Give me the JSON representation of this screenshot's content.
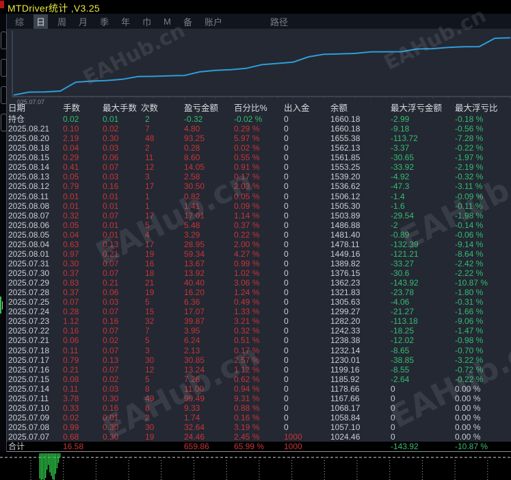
{
  "window": {
    "title": "MTDriver统计 ,V3.25"
  },
  "menu": {
    "items": [
      {
        "key": "summary",
        "label": "综",
        "selected": false
      },
      {
        "key": "day",
        "label": "日",
        "selected": true
      },
      {
        "key": "week",
        "label": "周",
        "selected": false
      },
      {
        "key": "month",
        "label": "月",
        "selected": false
      },
      {
        "key": "quarter",
        "label": "季",
        "selected": false
      },
      {
        "key": "year",
        "label": "年",
        "selected": false
      },
      {
        "key": "jin",
        "label": "巾",
        "selected": false
      },
      {
        "key": "m",
        "label": "M",
        "selected": false
      },
      {
        "key": "bei",
        "label": "备",
        "selected": false
      },
      {
        "key": "account",
        "label": "账户",
        "selected": false
      }
    ],
    "path_label": "路径"
  },
  "watermark_text": "EAHub.cn",
  "chart": {
    "start_label": "025.07.07"
  },
  "chart_data": [
    {
      "type": "line",
      "title": "余额曲线",
      "x": [
        "2025.07.07",
        "2025.07.08",
        "2025.07.09",
        "2025.07.10",
        "2025.07.11",
        "2025.07.14",
        "2025.07.15",
        "2025.07.16",
        "2025.07.17",
        "2025.07.18",
        "2025.07.21",
        "2025.07.22",
        "2025.07.23",
        "2025.07.24",
        "2025.07.25",
        "2025.07.28",
        "2025.07.29",
        "2025.07.30",
        "2025.07.31",
        "2025.08.01",
        "2025.08.04",
        "2025.08.05",
        "2025.08.06",
        "2025.08.07",
        "2025.08.08",
        "2025.08.11",
        "2025.08.12",
        "2025.08.13",
        "2025.08.14",
        "2025.08.15",
        "2025.08.18",
        "2025.08.20",
        "2025.08.21"
      ],
      "series": [
        {
          "name": "余额",
          "values": [
            1024.46,
            1057.1,
            1058.84,
            1068.17,
            1167.66,
            1178.66,
            1185.92,
            1199.16,
            1230.01,
            1232.14,
            1238.38,
            1242.33,
            1282.2,
            1299.27,
            1305.63,
            1321.83,
            1362.23,
            1376.15,
            1389.82,
            1449.16,
            1478.11,
            1481.4,
            1486.88,
            1503.89,
            1505.3,
            1506.12,
            1536.62,
            1539.2,
            1553.25,
            1561.85,
            1562.13,
            1655.38,
            1660.18
          ]
        }
      ],
      "ylim": [
        1000,
        1700
      ],
      "color": "#2e9ed8",
      "grid": false,
      "start_label": "025.07.07"
    },
    {
      "type": "bar",
      "title": "背景活动柱状图",
      "values": [
        37,
        39,
        38,
        39,
        36,
        24,
        17,
        28,
        33,
        38,
        39,
        30,
        22,
        14,
        6
      ],
      "color": "#2fd24a"
    }
  ],
  "table": {
    "headers": [
      "日期",
      "手数",
      "最大手数",
      "次数",
      "盈亏金额",
      "百分比%",
      "出入金",
      "余额",
      "最大浮亏金额",
      "最大浮亏比"
    ],
    "rows": [
      {
        "type": "position",
        "cells": [
          "持仓",
          "0.02",
          "0.01",
          "2",
          "-0.32",
          "-0.02 %",
          "0",
          "1660.18",
          "-2.99",
          "-0.18 %"
        ]
      },
      {
        "type": "day",
        "cells": [
          "2025.08.21",
          "0.10",
          "0.02",
          "7",
          "4.80",
          "0.29 %",
          "0",
          "1660.18",
          "-9.18",
          "-0.56 %"
        ]
      },
      {
        "type": "day",
        "cells": [
          "2025.08.20",
          "2.19",
          "0.30",
          "48",
          "93.25",
          "5.97 %",
          "0",
          "1655.38",
          "-113.72",
          "-7.28 %"
        ]
      },
      {
        "type": "day",
        "cells": [
          "2025.08.18",
          "0.04",
          "0.03",
          "2",
          "0.28",
          "0.02 %",
          "0",
          "1562.13",
          "-3.37",
          "-0.22 %"
        ]
      },
      {
        "type": "day",
        "cells": [
          "2025.08.15",
          "0.29",
          "0.06",
          "11",
          "8.60",
          "0.55 %",
          "0",
          "1561.85",
          "-30.65",
          "-1.97 %"
        ]
      },
      {
        "type": "day",
        "cells": [
          "2025.08.14",
          "0.41",
          "0.07",
          "12",
          "14.05",
          "0.91 %",
          "0",
          "1553.25",
          "-33.92",
          "-2.19 %"
        ]
      },
      {
        "type": "day",
        "cells": [
          "2025.08.13",
          "0.05",
          "0.03",
          "3",
          "2.58",
          "0.17 %",
          "0",
          "1539.20",
          "-4.92",
          "-0.32 %"
        ]
      },
      {
        "type": "day",
        "cells": [
          "2025.08.12",
          "0.79",
          "0.16",
          "17",
          "30.50",
          "2.03 %",
          "0",
          "1536.62",
          "-47.3",
          "-3.11 %"
        ]
      },
      {
        "type": "day",
        "cells": [
          "2025.08.11",
          "0.01",
          "0.01",
          "1",
          "0.82",
          "0.05 %",
          "0",
          "1506.12",
          "-1.4",
          "-0.09 %"
        ]
      },
      {
        "type": "day",
        "cells": [
          "2025.08.08",
          "0.01",
          "0.01",
          "1",
          "1.41",
          "0.09 %",
          "0",
          "1505.30",
          "-1.6",
          "-0.11 %"
        ]
      },
      {
        "type": "day",
        "cells": [
          "2025.08.07",
          "0.32",
          "0.07",
          "17",
          "17.01",
          "1.14 %",
          "0",
          "1503.89",
          "-29.54",
          "-1.98 %"
        ]
      },
      {
        "type": "day",
        "cells": [
          "2025.08.06",
          "0.05",
          "0.01",
          "5",
          "5.48",
          "0.37 %",
          "0",
          "1486.88",
          "-2",
          "-0.14 %"
        ]
      },
      {
        "type": "day",
        "cells": [
          "2025.08.05",
          "0.04",
          "0.01",
          "4",
          "3.29",
          "0.22 %",
          "0",
          "1481.40",
          "-0.89",
          "-0.06 %"
        ]
      },
      {
        "type": "day",
        "cells": [
          "2025.08.04",
          "0.63",
          "0.13",
          "17",
          "28.95",
          "2.00 %",
          "0",
          "1478.11",
          "-132.39",
          "-9.14 %"
        ]
      },
      {
        "type": "day",
        "cells": [
          "2025.08.01",
          "0.97",
          "0.21",
          "19",
          "59.34",
          "4.27 %",
          "0",
          "1449.16",
          "-121.21",
          "-8.64 %"
        ]
      },
      {
        "type": "day",
        "cells": [
          "2025.07.31",
          "0.30",
          "0.07",
          "16",
          "13.67",
          "0.99 %",
          "0",
          "1389.82",
          "-33.27",
          "-2.42 %"
        ]
      },
      {
        "type": "day",
        "cells": [
          "2025.07.30",
          "0.37",
          "0.07",
          "18",
          "13.92",
          "1.02 %",
          "0",
          "1376.15",
          "-30.6",
          "-2.22 %"
        ]
      },
      {
        "type": "day",
        "cells": [
          "2025.07.29",
          "0.83",
          "0.21",
          "21",
          "40.40",
          "3.06 %",
          "0",
          "1362.23",
          "-143.92",
          "-10.87 %"
        ]
      },
      {
        "type": "day",
        "cells": [
          "2025.07.28",
          "0.37",
          "0.06",
          "19",
          "16.20",
          "1.24 %",
          "0",
          "1321.83",
          "-23.78",
          "-1.80 %"
        ]
      },
      {
        "type": "day",
        "cells": [
          "2025.07.25",
          "0.07",
          "0.03",
          "5",
          "6.36",
          "0.49 %",
          "0",
          "1305.63",
          "-4.06",
          "-0.31 %"
        ]
      },
      {
        "type": "day",
        "cells": [
          "2025.07.24",
          "0.28",
          "0.07",
          "15",
          "17.07",
          "1.33 %",
          "0",
          "1299.27",
          "-21.27",
          "-1.66 %"
        ]
      },
      {
        "type": "day",
        "cells": [
          "2025.07.23",
          "1.12",
          "0.16",
          "32",
          "39.87",
          "3.21 %",
          "0",
          "1282.20",
          "-113.18",
          "-9.06 %"
        ]
      },
      {
        "type": "day",
        "cells": [
          "2025.07.22",
          "0.16",
          "0.07",
          "7",
          "3.95",
          "0.32 %",
          "0",
          "1242.33",
          "-18.25",
          "-1.47 %"
        ]
      },
      {
        "type": "day",
        "cells": [
          "2025.07.21",
          "0.06",
          "0.02",
          "5",
          "6.24",
          "0.51 %",
          "0",
          "1238.38",
          "-12.02",
          "-0.98 %"
        ]
      },
      {
        "type": "day",
        "cells": [
          "2025.07.18",
          "0.11",
          "0.07",
          "3",
          "2.13",
          "0.17 %",
          "0",
          "1232.14",
          "-8.65",
          "-0.70 %"
        ]
      },
      {
        "type": "day",
        "cells": [
          "2025.07.17",
          "0.79",
          "0.13",
          "30",
          "30.85",
          "2.57 %",
          "0",
          "1230.01",
          "-38.85",
          "-3.22 %"
        ]
      },
      {
        "type": "day",
        "cells": [
          "2025.07.16",
          "0.21",
          "0.07",
          "12",
          "13.24",
          "1.12 %",
          "0",
          "1199.16",
          "-8.55",
          "-0.72 %"
        ]
      },
      {
        "type": "day",
        "cells": [
          "2025.07.15",
          "0.08",
          "0.02",
          "5",
          "7.26",
          "0.62 %",
          "0",
          "1185.92",
          "-2.64",
          "-0.22 %"
        ]
      },
      {
        "type": "day",
        "cells": [
          "2025.07.14",
          "0.11",
          "0.03",
          "8",
          "11.00",
          "0.94 %",
          "0",
          "1178.66",
          "0",
          "0.00 %"
        ]
      },
      {
        "type": "day",
        "cells": [
          "2025.07.11",
          "3.78",
          "0.30",
          "49",
          "99.49",
          "9.31 %",
          "0",
          "1167.66",
          "0",
          "0.00 %"
        ]
      },
      {
        "type": "day",
        "cells": [
          "2025.07.10",
          "0.33",
          "0.16",
          "8",
          "9.33",
          "0.88 %",
          "0",
          "1068.17",
          "0",
          "0.00 %"
        ]
      },
      {
        "type": "day",
        "cells": [
          "2025.07.09",
          "0.02",
          "0.01",
          "2",
          "1.74",
          "0.16 %",
          "0",
          "1058.84",
          "0",
          "0.00 %"
        ]
      },
      {
        "type": "day",
        "cells": [
          "2025.07.08",
          "0.99",
          "0.30",
          "30",
          "32.64",
          "3.19 %",
          "0",
          "1057.10",
          "0",
          "0.00 %"
        ]
      },
      {
        "type": "day",
        "cells": [
          "2025.07.07",
          "0.68",
          "0.30",
          "19",
          "24.46",
          "2.45 %",
          "1000",
          "1024.46",
          "0",
          "0.00 %"
        ]
      },
      {
        "type": "total",
        "cells": [
          "合计",
          "16.58",
          "",
          "",
          "659.86",
          "65.99 %",
          "1000",
          "",
          "-143.92",
          "-10.87 %"
        ]
      }
    ]
  },
  "colors": {
    "profit_red": "#c93434",
    "loss_green": "#35bd6d",
    "neutral_gray": "#c9ced4",
    "balance_line": "#2e9ed8",
    "bars_green": "#2fd24a",
    "title_yellow": "#e9e83e"
  }
}
